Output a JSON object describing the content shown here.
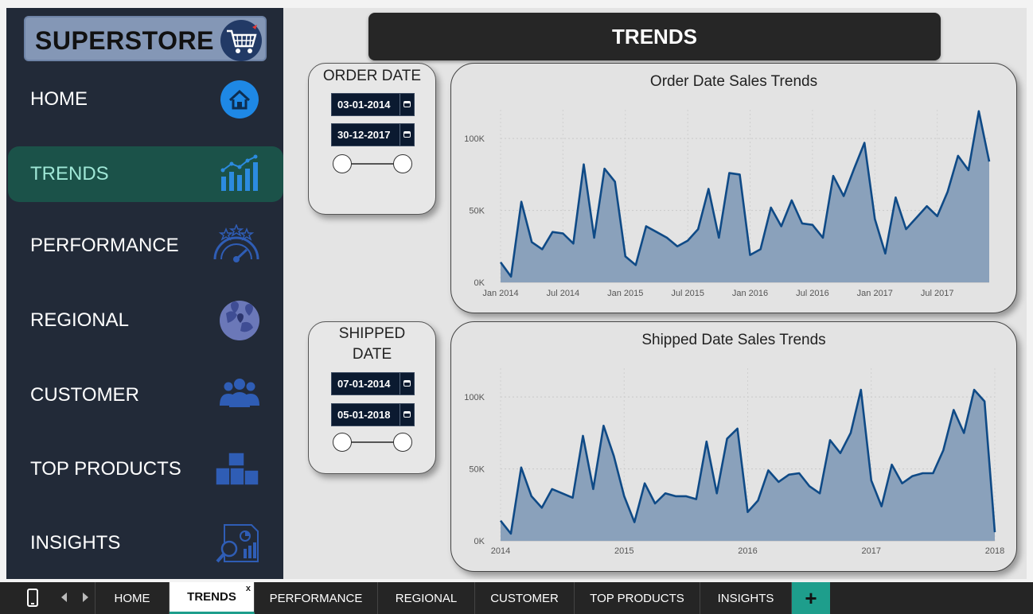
{
  "app": {
    "logo_text": "SUPERSTORE",
    "page_title": "TRENDS"
  },
  "sidebar": {
    "items": [
      {
        "label": "HOME",
        "icon": "home-icon",
        "active": false
      },
      {
        "label": "TRENDS",
        "icon": "trend-bars-icon",
        "active": true
      },
      {
        "label": "PERFORMANCE",
        "icon": "gauge-stars-icon",
        "active": false
      },
      {
        "label": "REGIONAL",
        "icon": "globe-pins-icon",
        "active": false
      },
      {
        "label": "CUSTOMER",
        "icon": "people-group-icon",
        "active": false
      },
      {
        "label": "TOP PRODUCTS",
        "icon": "boxes-icon",
        "active": false
      },
      {
        "label": "INSIGHTS",
        "icon": "report-magnifier-icon",
        "active": false
      }
    ]
  },
  "slicers": {
    "order": {
      "title": "ORDER DATE",
      "start": "03-01-2014",
      "end": "30-12-2017"
    },
    "shipped": {
      "title_line1": "SHIPPED",
      "title_line2": "DATE",
      "start": "07-01-2014",
      "end": "05-01-2018"
    }
  },
  "colors": {
    "sidebar_bg": "#222a38",
    "active_bg": "#1b5249",
    "active_text": "#9fe7d6",
    "line": "#0f4a86",
    "area": "#8aa1bb",
    "accent": "#1e9e8c"
  },
  "chart_data": [
    {
      "type": "area",
      "title": "Order Date Sales Trends",
      "x_tick_labels": [
        "Jan 2014",
        "Jul 2014",
        "Jan 2015",
        "Jul 2015",
        "Jan 2016",
        "Jul 2016",
        "Jan 2017",
        "Jul 2017"
      ],
      "y_tick_labels": [
        "0K",
        "50K",
        "100K"
      ],
      "ylim": [
        0,
        120000
      ],
      "x_unit": "month",
      "x_start": "2014-01",
      "values": [
        14000,
        4000,
        56000,
        28000,
        23000,
        35000,
        34000,
        27000,
        82000,
        31000,
        79000,
        70000,
        18000,
        12000,
        39000,
        35000,
        31000,
        25000,
        29000,
        37000,
        65000,
        31000,
        76000,
        75000,
        19000,
        23000,
        52000,
        39000,
        57000,
        41000,
        40000,
        31000,
        74000,
        60000,
        79000,
        97000,
        44000,
        20000,
        59000,
        37000,
        45000,
        53000,
        46000,
        63000,
        88000,
        78000,
        119000,
        84000
      ],
      "grid": true
    },
    {
      "type": "area",
      "title": "Shipped Date Sales Trends",
      "x_tick_labels": [
        "2014",
        "2015",
        "2016",
        "2017",
        "2018"
      ],
      "y_tick_labels": [
        "0K",
        "50K",
        "100K"
      ],
      "ylim": [
        0,
        120000
      ],
      "x_unit": "month",
      "x_start": "2014-01",
      "values": [
        14000,
        5000,
        51000,
        31000,
        23000,
        36000,
        33000,
        30000,
        73000,
        36000,
        80000,
        59000,
        31000,
        13000,
        40000,
        26000,
        33000,
        31000,
        31000,
        29000,
        69000,
        33000,
        71000,
        78000,
        20000,
        28000,
        49000,
        41000,
        46000,
        47000,
        38000,
        33000,
        70000,
        61000,
        75000,
        105000,
        42000,
        24000,
        53000,
        40000,
        45000,
        47000,
        47000,
        63000,
        91000,
        75000,
        105000,
        97000,
        6000
      ],
      "grid": true
    }
  ],
  "tabs": [
    {
      "label": "HOME",
      "active": false
    },
    {
      "label": "TRENDS",
      "active": true
    },
    {
      "label": "PERFORMANCE",
      "active": false
    },
    {
      "label": "REGIONAL",
      "active": false
    },
    {
      "label": "CUSTOMER",
      "active": false
    },
    {
      "label": "TOP PRODUCTS",
      "active": false
    },
    {
      "label": "INSIGHTS",
      "active": false
    }
  ],
  "tabbar": {
    "close_glyph": "x",
    "add_glyph": "+"
  }
}
